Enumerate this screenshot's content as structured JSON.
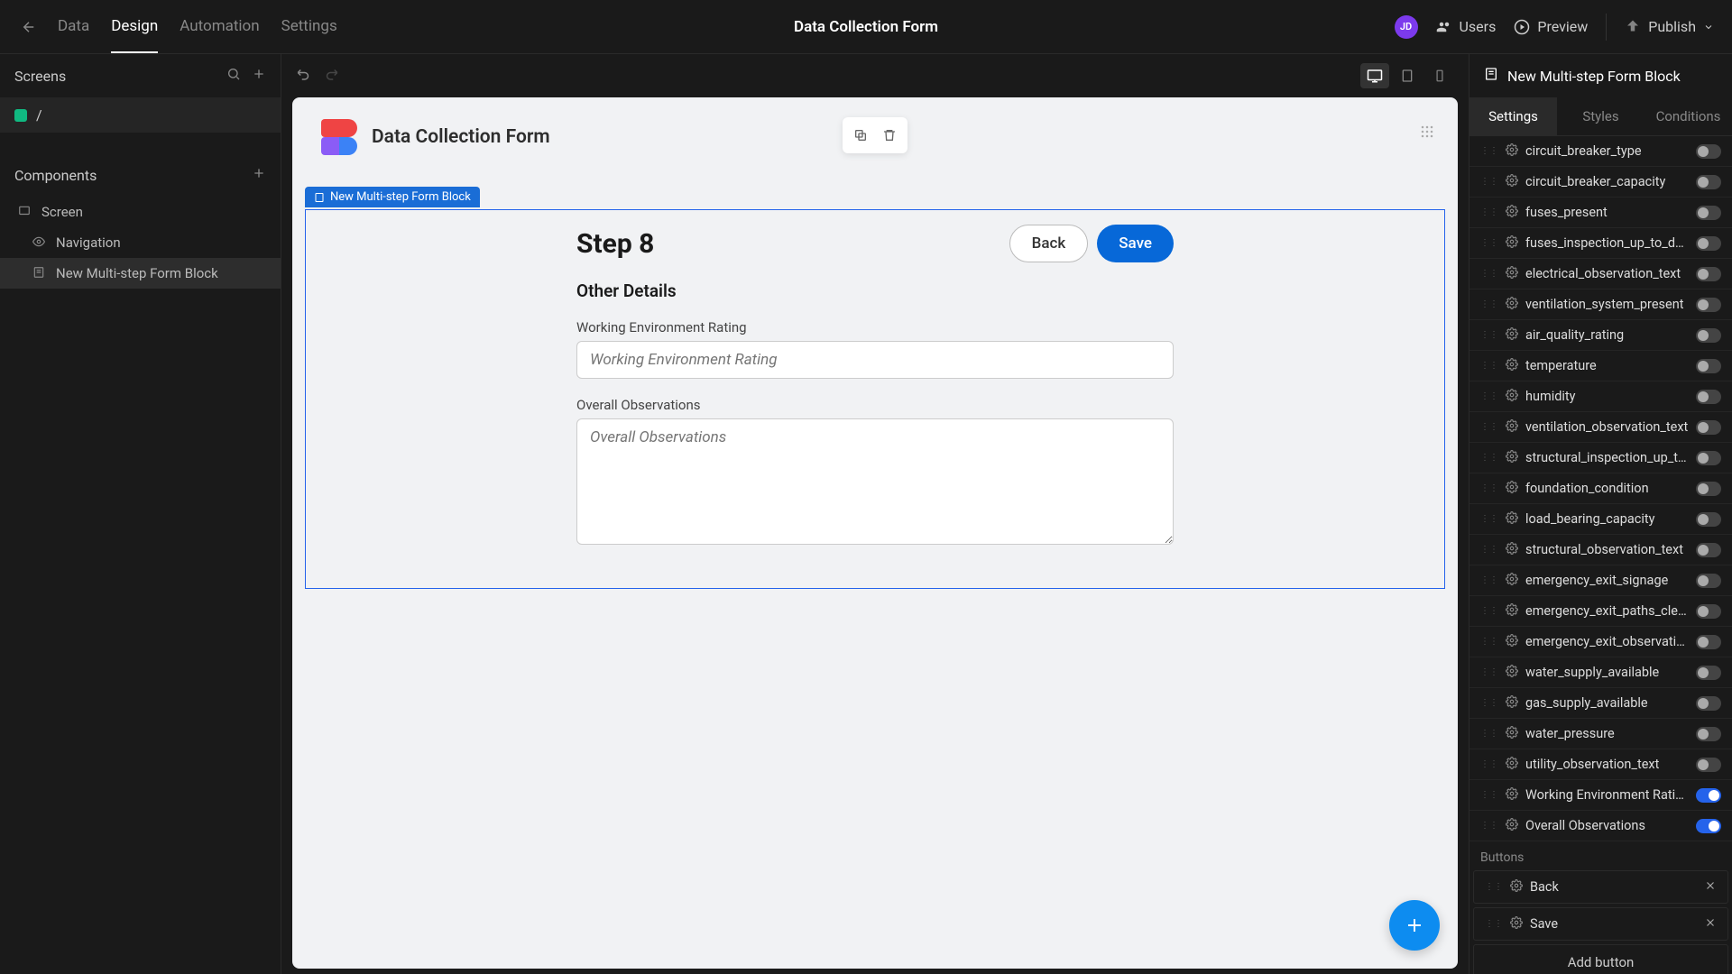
{
  "topbar": {
    "nav": {
      "data": "Data",
      "design": "Design",
      "automation": "Automation",
      "settings": "Settings"
    },
    "title": "Data Collection Form",
    "avatar": "JD",
    "users": "Users",
    "preview": "Preview",
    "publish": "Publish"
  },
  "left": {
    "screens_label": "Screens",
    "screen_name": "/",
    "components_label": "Components",
    "tree": {
      "screen": "Screen",
      "navigation": "Navigation",
      "formblock": "New Multi-step Form Block"
    }
  },
  "canvas": {
    "app_title": "Data Collection Form",
    "block_label": "New Multi-step Form Block",
    "step_title": "Step 8",
    "back_btn": "Back",
    "save_btn": "Save",
    "subsection": "Other Details",
    "field1_label": "Working Environment Rating",
    "field1_placeholder": "Working Environment Rating",
    "field2_label": "Overall Observations",
    "field2_placeholder": "Overall Observations"
  },
  "right": {
    "header": "New Multi-step Form Block",
    "tabs": {
      "settings": "Settings",
      "styles": "Styles",
      "conditions": "Conditions"
    },
    "fields": [
      {
        "name": "circuit_breaker_type",
        "on": false
      },
      {
        "name": "circuit_breaker_capacity",
        "on": false
      },
      {
        "name": "fuses_present",
        "on": false
      },
      {
        "name": "fuses_inspection_up_to_date",
        "on": false
      },
      {
        "name": "electrical_observation_text",
        "on": false
      },
      {
        "name": "ventilation_system_present",
        "on": false
      },
      {
        "name": "air_quality_rating",
        "on": false
      },
      {
        "name": "temperature",
        "on": false
      },
      {
        "name": "humidity",
        "on": false
      },
      {
        "name": "ventilation_observation_text",
        "on": false
      },
      {
        "name": "structural_inspection_up_to...",
        "on": false
      },
      {
        "name": "foundation_condition",
        "on": false
      },
      {
        "name": "load_bearing_capacity",
        "on": false
      },
      {
        "name": "structural_observation_text",
        "on": false
      },
      {
        "name": "emergency_exit_signage",
        "on": false
      },
      {
        "name": "emergency_exit_paths_clear",
        "on": false
      },
      {
        "name": "emergency_exit_observatio...",
        "on": false
      },
      {
        "name": "water_supply_available",
        "on": false
      },
      {
        "name": "gas_supply_available",
        "on": false
      },
      {
        "name": "water_pressure",
        "on": false
      },
      {
        "name": "utility_observation_text",
        "on": false
      },
      {
        "name": "Working Environment Rating",
        "on": true
      },
      {
        "name": "Overall Observations",
        "on": true
      }
    ],
    "buttons_label": "Buttons",
    "buttons": [
      {
        "name": "Back"
      },
      {
        "name": "Save"
      }
    ],
    "add_button": "Add button"
  }
}
